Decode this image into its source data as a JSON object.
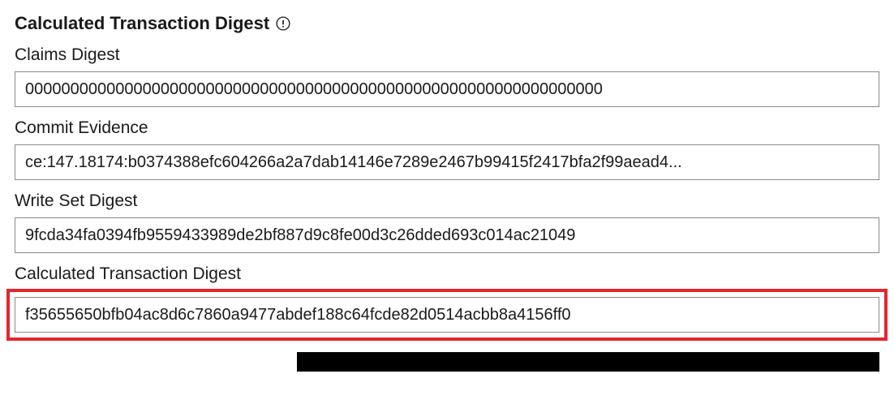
{
  "section": {
    "title": "Calculated Transaction Digest"
  },
  "fields": {
    "claims_digest": {
      "label": "Claims Digest",
      "value": "0000000000000000000000000000000000000000000000000000000000000000"
    },
    "commit_evidence": {
      "label": "Commit Evidence",
      "value": "ce:147.18174:b0374388efc604266a2a7dab14146e7289e2467b99415f2417bfa2f99aead4..."
    },
    "write_set_digest": {
      "label": "Write Set Digest",
      "value": "9fcda34fa0394fb9559433989de2bf887d9c8fe00d3c26dded693c014ac21049"
    },
    "calculated_transaction_digest": {
      "label": "Calculated Transaction Digest",
      "value": "f35655650bfb04ac8d6c7860a9477abdef188c64fcde82d0514acbb8a4156ff0"
    }
  }
}
